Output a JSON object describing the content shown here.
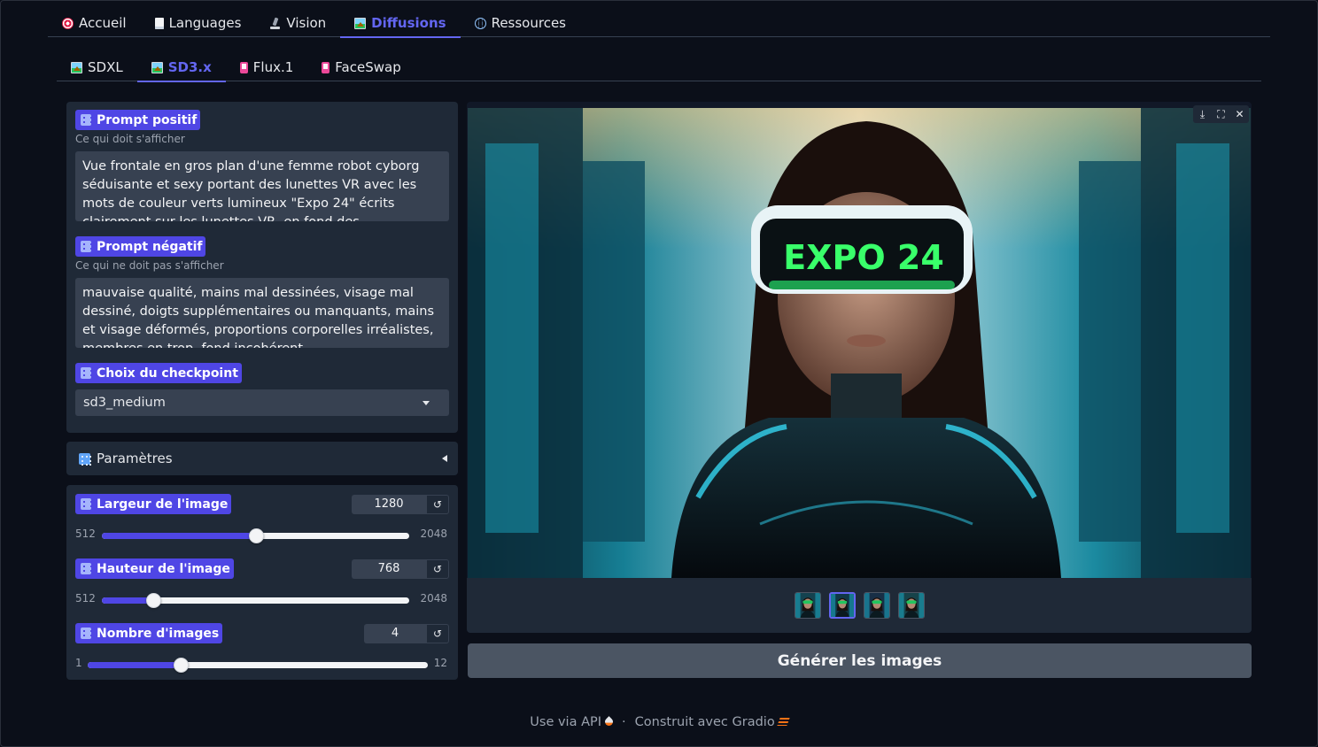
{
  "top_tabs": [
    {
      "label": "Accueil",
      "icon": "dart-icon"
    },
    {
      "label": "Languages",
      "icon": "page-icon"
    },
    {
      "label": "Vision",
      "icon": "microscope-icon"
    },
    {
      "label": "Diffusions",
      "icon": "picture-icon",
      "active": true
    },
    {
      "label": "Ressources",
      "icon": "globe-icon"
    }
  ],
  "sub_tabs": [
    {
      "label": "SDXL",
      "icon": "picture-icon"
    },
    {
      "label": "SD3.x",
      "icon": "picture-icon",
      "active": true
    },
    {
      "label": "Flux.1",
      "icon": "phone-icon"
    },
    {
      "label": "FaceSwap",
      "icon": "phone-icon"
    }
  ],
  "prompt_positive": {
    "label": "Prompt positif",
    "help": "Ce qui doit s'afficher",
    "value": "Vue frontale en gros plan d'une femme robot cyborg séduisante et sexy portant des lunettes VR avec les mots de couleur verts lumineux \"Expo 24\" écrits clairement sur les lunettes VR, en fond des"
  },
  "prompt_negative": {
    "label": "Prompt négatif",
    "help": "Ce qui ne doit pas s'afficher",
    "value": "mauvaise qualité, mains mal dessinées, visage mal dessiné, doigts supplémentaires ou manquants, mains et visage déformés, proportions corporelles irréalistes, membres en trop, fond incohérent"
  },
  "checkpoint": {
    "label": "Choix du checkpoint",
    "value": "sd3_medium"
  },
  "parameters_accordion": {
    "label": "Paramètres",
    "icon": "parameters-icon"
  },
  "sliders": {
    "width": {
      "label": "Largeur de l'image",
      "value": "1280",
      "min": "512",
      "max": "2048",
      "fraction": 0.5
    },
    "height": {
      "label": "Hauteur de l'image",
      "value": "768",
      "min": "512",
      "max": "2048",
      "fraction": 0.1667
    },
    "count": {
      "label": "Nombre d'images",
      "value": "4",
      "min": "1",
      "max": "12",
      "fraction": 0.2727
    }
  },
  "gallery": {
    "image_text": "EXPO 24",
    "toolbar": [
      "download-icon",
      "fullscreen-icon",
      "close-icon"
    ],
    "thumbnail_count": 4,
    "selected_thumbnail": 2
  },
  "generate_button": "Générer les images",
  "footer": {
    "api_link": "Use via API",
    "separator": "·",
    "built_with": "Construit avec Gradio"
  },
  "colors": {
    "accent": "#4f46e5",
    "background": "#0b0f19",
    "panel": "#1f2937",
    "input": "#374151"
  }
}
